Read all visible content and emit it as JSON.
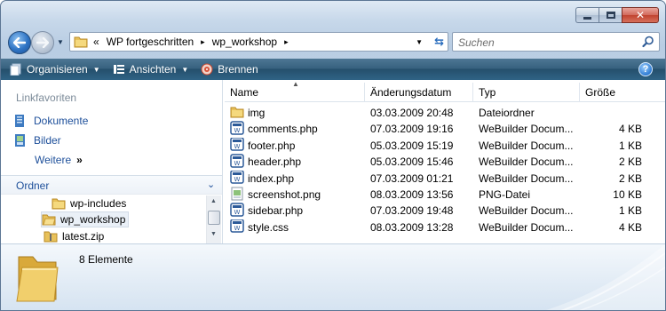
{
  "window": {
    "caption": {
      "minimize": "minimize",
      "maximize": "maximize",
      "close": "✕"
    }
  },
  "address": {
    "overflow": "«",
    "crumbs": [
      "WP fortgeschritten",
      "wp_workshop"
    ],
    "separator": "▸"
  },
  "search": {
    "placeholder": "Suchen"
  },
  "toolbar": {
    "organize": "Organisieren",
    "views": "Ansichten",
    "burn": "Brennen",
    "help": "?"
  },
  "nav_pane": {
    "favorites_title": "Linkfavoriten",
    "favorites": [
      "Dokumente",
      "Bilder"
    ],
    "more": "Weitere",
    "more_chevron": "»",
    "folders_title": "Ordner",
    "tree": [
      "wp-includes",
      "wp_workshop",
      "latest.zip"
    ]
  },
  "columns": {
    "name": "Name",
    "date": "Änderungsdatum",
    "type": "Typ",
    "size": "Größe"
  },
  "files": [
    {
      "name": "img",
      "date": "03.03.2009 20:48",
      "type": "Dateiordner",
      "size": "",
      "icon": "folder-icon"
    },
    {
      "name": "comments.php",
      "date": "07.03.2009 19:16",
      "type": "WeBuilder Docum...",
      "size": "4 KB",
      "icon": "webuilder-file-icon"
    },
    {
      "name": "footer.php",
      "date": "05.03.2009 15:19",
      "type": "WeBuilder Docum...",
      "size": "1 KB",
      "icon": "webuilder-file-icon"
    },
    {
      "name": "header.php",
      "date": "05.03.2009 15:46",
      "type": "WeBuilder Docum...",
      "size": "2 KB",
      "icon": "webuilder-file-icon"
    },
    {
      "name": "index.php",
      "date": "07.03.2009 01:21",
      "type": "WeBuilder Docum...",
      "size": "2 KB",
      "icon": "webuilder-file-icon"
    },
    {
      "name": "screenshot.png",
      "date": "08.03.2009 13:56",
      "type": "PNG-Datei",
      "size": "10 KB",
      "icon": "image-file-icon"
    },
    {
      "name": "sidebar.php",
      "date": "07.03.2009 19:48",
      "type": "WeBuilder Docum...",
      "size": "1 KB",
      "icon": "webuilder-file-icon"
    },
    {
      "name": "style.css",
      "date": "08.03.2009 13:28",
      "type": "WeBuilder Docum...",
      "size": "4 KB",
      "icon": "webuilder-file-icon"
    }
  ],
  "details": {
    "item_count": "8 Elemente"
  },
  "colors": {
    "toolbar": "#2f6385",
    "link": "#1d4f9a",
    "folder": "#e8c15a"
  }
}
